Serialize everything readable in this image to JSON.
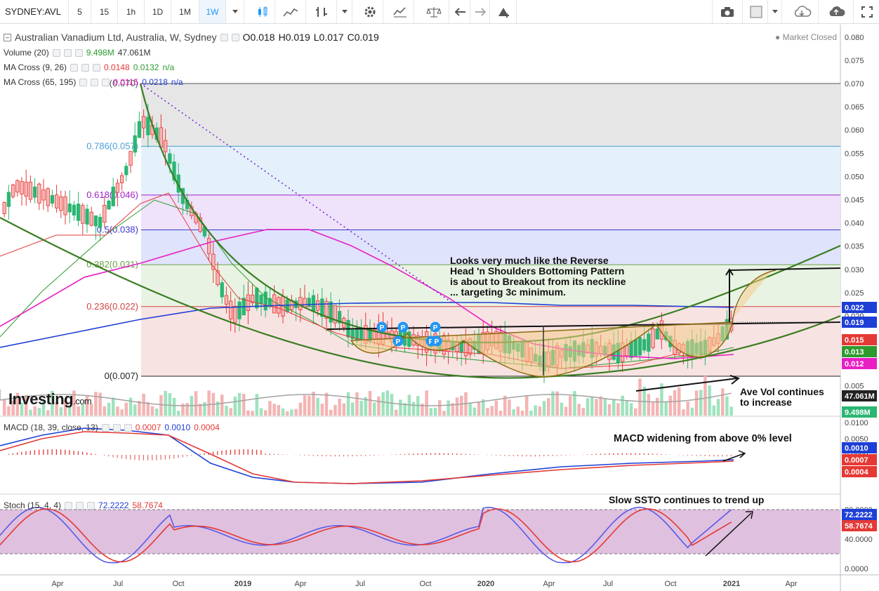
{
  "toolbar": {
    "symbol": "SYDNEY:AVL",
    "intervals": [
      "5",
      "15",
      "1h",
      "1D",
      "1M",
      "1W"
    ],
    "active_interval": "1W"
  },
  "legend": {
    "title": "Australian Vanadium Ltd, Australia, W, Sydney",
    "ohlc": {
      "o": "O0.018",
      "h": "H0.019",
      "l": "L0.017",
      "c": "C0.019"
    },
    "market_status": "Market Closed",
    "volume": {
      "label": "Volume (20)",
      "v1": "9.498M",
      "v2": "47.061M"
    },
    "ma1": {
      "label": "MA Cross (9, 26)",
      "v1": "0.0148",
      "v2": "0.0132",
      "v3": "n/a"
    },
    "ma2": {
      "label": "MA Cross (65, 195)",
      "v1": "0.0115",
      "v2": "0.0218",
      "v3": "n/a"
    }
  },
  "price_axis": [
    "0.080",
    "0.075",
    "0.070",
    "0.065",
    "0.060",
    "0.055",
    "0.050",
    "0.045",
    "0.040",
    "0.035",
    "0.030",
    "0.025",
    "0.020",
    "0.015",
    "0.010",
    "0.005"
  ],
  "price_tags": [
    {
      "label": "0.022",
      "color": "#1e3fd6"
    },
    {
      "label": "0.019",
      "color": "#1e3fd6"
    },
    {
      "label": "0.015",
      "color": "#e53935"
    },
    {
      "label": "0.013",
      "color": "#2e9b2e"
    },
    {
      "label": "0.012",
      "color": "#e91ec4"
    },
    {
      "label": "47.061M",
      "color": "#222222"
    },
    {
      "label": "9.498M",
      "color": "#2bb673"
    }
  ],
  "fib_levels": [
    {
      "label": "1(0.070)",
      "value": 0.07,
      "fill": "#e6e6e6",
      "line": "#555555"
    },
    {
      "label": "0.786(0.057)",
      "value": 0.0565,
      "fill": "#e4f0fa",
      "line": "#4a9fd6"
    },
    {
      "label": "0.618(0.046)",
      "value": 0.046,
      "fill": "#efe2fb",
      "line": "#a020c8"
    },
    {
      "label": "0.5(0.038)",
      "value": 0.0385,
      "fill": "#dfe3fb",
      "line": "#3a3ad0"
    },
    {
      "label": "0.382(0.031)",
      "value": 0.031,
      "fill": "#e9f3e4",
      "line": "#6a9f4a"
    },
    {
      "label": "0.236(0.022)",
      "value": 0.022,
      "fill": "#f8e3e3",
      "line": "#d04545"
    },
    {
      "label": "0(0.007)",
      "value": 0.007,
      "fill": "#f8e3e3",
      "line": "#222222"
    }
  ],
  "annotations": {
    "pattern": "Looks very much like the Reverse\nHead 'n Shoulders Bottoming Pattern\nis about to Breakout from its neckline\n ... targeting 3c minimum.",
    "volume": "Ave Vol continues\nto increase",
    "macd": "MACD widening from above 0% level",
    "stoch": "Slow SSTO continues to trend up"
  },
  "macd": {
    "label": "MACD (18, 39, close, 13)",
    "v1": "0.0007",
    "v2": "0.0010",
    "v3": "0.0004",
    "axis": [
      "0.0100",
      "0.0050",
      "0.0000",
      "-0.0050"
    ],
    "tags": [
      {
        "label": "0.0010",
        "color": "#1e3fd6"
      },
      {
        "label": "0.0007",
        "color": "#e53935"
      },
      {
        "label": "0.0004",
        "color": "#e53935"
      }
    ]
  },
  "stoch": {
    "label": "Stoch (15, 4, 4)",
    "v1": "72.2222",
    "v2": "58.7674",
    "axis": [
      "80.0000",
      "40.0000",
      "0.0000"
    ],
    "tags": [
      {
        "label": "72.2222",
        "color": "#1e3fd6"
      },
      {
        "label": "58.7674",
        "color": "#e53935"
      }
    ]
  },
  "time_axis": [
    "Apr",
    "Jul",
    "Oct",
    "2019",
    "Apr",
    "Jul",
    "Oct",
    "2020",
    "Apr",
    "Jul",
    "Oct",
    "2021",
    "Apr"
  ],
  "watermark": {
    "brand": "Investing",
    "suffix": ".com"
  },
  "colors": {
    "up": "#2bb673",
    "down": "#e53935",
    "ma_fast": "#e53935",
    "ma_slow": "#2e9b2e",
    "ma_pink": "#e91ec4",
    "ma_blue": "#1e3fd6"
  }
}
